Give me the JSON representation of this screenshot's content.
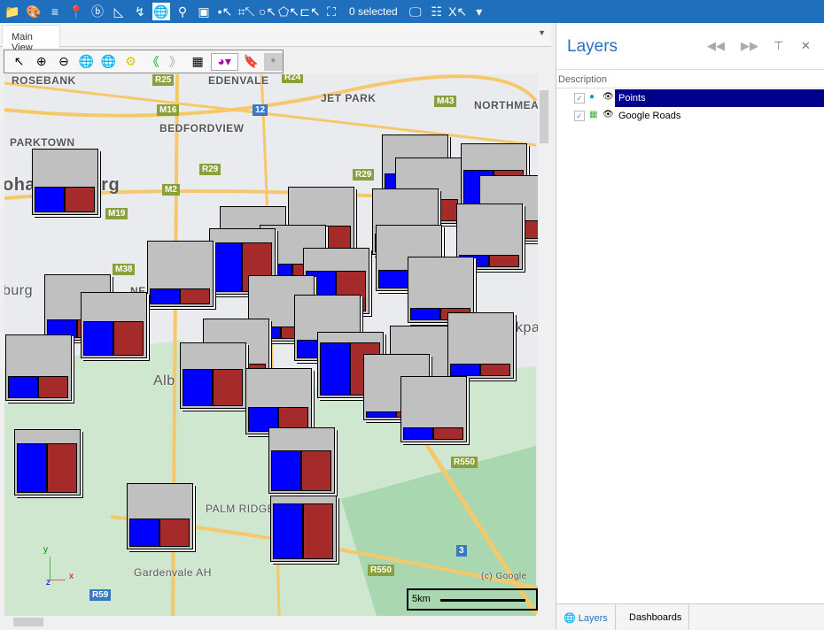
{
  "toolbar": {
    "selected_text": "0 selected",
    "icons": [
      "open-folder-icon",
      "paint-palette-icon",
      "layers-stack-icon",
      "google-maps-icon",
      "bing-icon",
      "measure-angle-icon",
      "route-icon",
      "globe-icon",
      "map-pin-icon",
      "map-frame-icon",
      "select-point-icon",
      "select-rectangle-icon",
      "select-circle-icon",
      "select-polygon-icon",
      "select-line-icon",
      "clear-selection-icon",
      "monitor-icon",
      "table-icon",
      "excel-export-icon",
      "dropdown-arrow-icon"
    ]
  },
  "tab": {
    "main_view": "Main View"
  },
  "map_tools": {
    "icons": [
      "pointer-icon",
      "zoom-in-icon",
      "zoom-out-icon",
      "globe-icon",
      "full-extent-icon",
      "settings-icon",
      "back-icon",
      "forward-icon",
      "grid-icon",
      "color-palette-dropdown",
      "bookmark-icon"
    ],
    "extra": "*"
  },
  "map": {
    "labels": [
      "ROSEBANK",
      "EDENVALE",
      "JET PARK",
      "NORTHMEA",
      "PARKTOWN",
      "BEDFORDVIEW",
      "ohannesburg",
      "burg",
      "NE",
      "Alb",
      "kpa",
      "PALM RIDGE",
      "Gardenvale AH",
      "(c) Google"
    ],
    "shields": [
      "R25",
      "R24",
      "M16",
      "12",
      "M43",
      "R29",
      "R29",
      "M2",
      "M19",
      "M38",
      "R550",
      "R550",
      "3",
      "R59"
    ],
    "axis": {
      "y": "y",
      "x": "x",
      "z": "z"
    },
    "scale_label": "5km",
    "colors": {
      "series_a": "#0000ff",
      "series_b": "#a52a2a",
      "box": "#c0c0c0"
    }
  },
  "layers_panel": {
    "title": "Layers",
    "column_header": "Description",
    "layers": [
      {
        "name": "Points",
        "checked": true,
        "selected": true
      },
      {
        "name": "Google Roads",
        "checked": true,
        "selected": false
      }
    ],
    "tabs": [
      "Layers",
      "Dashboards"
    ]
  }
}
